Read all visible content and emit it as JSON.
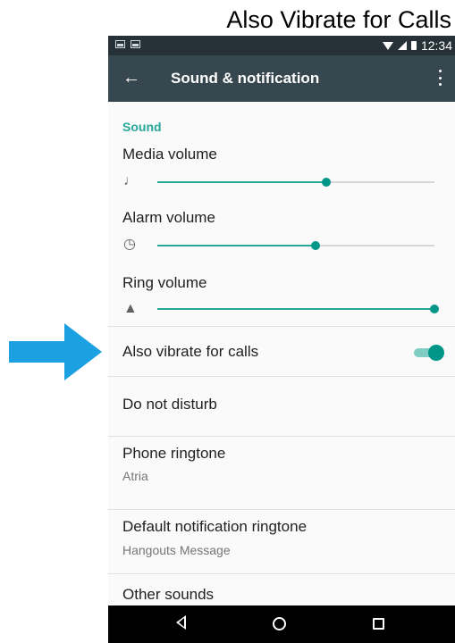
{
  "caption": "Also Vibrate for Calls",
  "status_bar": {
    "time": "12:34"
  },
  "app_bar": {
    "title": "Sound & notification"
  },
  "sound": {
    "header": "Sound",
    "volumes": [
      {
        "label": "Media volume",
        "icon": "music-note-icon",
        "level": 0.61
      },
      {
        "label": "Alarm volume",
        "icon": "alarm-clock-icon",
        "level": 0.57
      },
      {
        "label": "Ring volume",
        "icon": "bell-icon",
        "level": 1.0
      }
    ]
  },
  "prefs": {
    "vibrate": {
      "label": "Also vibrate for calls",
      "checked": true
    },
    "dnd": {
      "label": "Do not disturb"
    },
    "phone_ringtone": {
      "label": "Phone ringtone",
      "value": "Atria"
    },
    "notif_ringtone": {
      "label": "Default notification ringtone",
      "value": "Hangouts Message"
    },
    "other_sounds": {
      "label": "Other sounds"
    }
  },
  "nav_bar": {
    "icons": [
      "back-icon",
      "home-icon",
      "recents-icon"
    ]
  },
  "colors": {
    "accent": "#009688",
    "app_bar": "#37474f",
    "status_bar": "#263238",
    "arrow": "#1ba1e2"
  }
}
